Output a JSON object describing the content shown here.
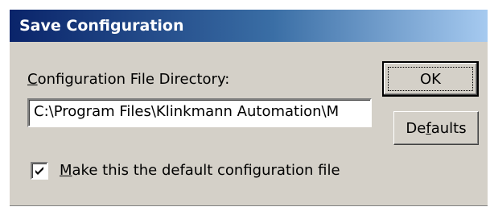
{
  "window": {
    "title": "Save Configuration"
  },
  "directory": {
    "label_mnemonic": "C",
    "label_rest": "onfiguration File Directory:",
    "value": "C:\\Program Files\\Klinkmann Automation\\M"
  },
  "buttons": {
    "ok_label": "OK",
    "defaults_pre": "De",
    "defaults_mnemonic": "f",
    "defaults_post": "aults"
  },
  "default_checkbox": {
    "checked": true,
    "label_mnemonic": "M",
    "label_rest": "ake this the default configuration file"
  },
  "icons": {
    "checkmark": "check-icon"
  },
  "colors": {
    "titlebar_start": "#0a246a",
    "titlebar_end": "#a6caf0",
    "dialog_face": "#d4d0c8"
  }
}
